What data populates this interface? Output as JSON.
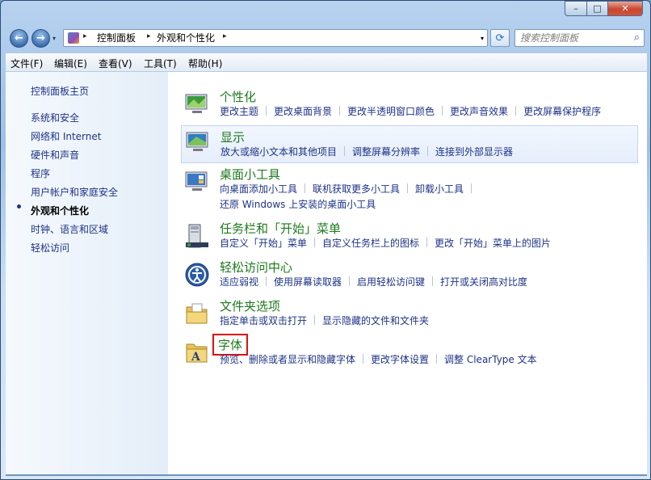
{
  "window": {
    "minimize": "–",
    "maximize": "□",
    "close": "✕"
  },
  "nav": {
    "back_glyph": "←",
    "forward_glyph": "→",
    "dropdown_glyph": "▾",
    "breadcrumb": [
      "控制面板",
      "外观和个性化"
    ],
    "crumb_sep": "▸",
    "address_dropdown": "▾",
    "refresh_glyph": "⟳",
    "search_placeholder": "搜索控制面板",
    "search_icon": "⌕"
  },
  "menu": [
    "文件(F)",
    "编辑(E)",
    "查看(V)",
    "工具(T)",
    "帮助(H)"
  ],
  "sidebar": {
    "home": "控制面板主页",
    "items": [
      "系统和安全",
      "网络和 Internet",
      "硬件和声音",
      "程序",
      "用户帐户和家庭安全",
      "外观和个性化",
      "时钟、语言和区域",
      "轻松访问"
    ],
    "current_index": 5
  },
  "categories": [
    {
      "title": "个性化",
      "icon": "personalization-icon",
      "link_lines": [
        [
          "更改主题",
          "更改桌面背景",
          "更改半透明窗口颜色",
          "更改声音效果",
          "更改屏幕保护程序"
        ]
      ]
    },
    {
      "title": "显示",
      "icon": "display-icon",
      "link_lines": [
        [
          "放大或缩小文本和其他项目",
          "调整屏幕分辨率",
          "连接到外部显示器"
        ]
      ]
    },
    {
      "title": "桌面小工具",
      "icon": "gadgets-icon",
      "link_lines": [
        [
          "向桌面添加小工具",
          "联机获取更多小工具",
          "卸载小工具"
        ],
        [
          "还原 Windows 上安装的桌面小工具"
        ]
      ]
    },
    {
      "title": "任务栏和「开始」菜单",
      "icon": "taskbar-icon",
      "link_lines": [
        [
          "自定义「开始」菜单",
          "自定义任务栏上的图标",
          "更改「开始」菜单上的图片"
        ]
      ]
    },
    {
      "title": "轻松访问中心",
      "icon": "ease-of-access-icon",
      "link_lines": [
        [
          "适应弱视",
          "使用屏幕读取器",
          "启用轻松访问键",
          "打开或关闭高对比度"
        ]
      ]
    },
    {
      "title": "文件夹选项",
      "icon": "folder-options-icon",
      "link_lines": [
        [
          "指定单击或双击打开",
          "显示隐藏的文件和文件夹"
        ]
      ]
    },
    {
      "title": "字体",
      "icon": "fonts-icon",
      "link_lines": [
        [
          "预览、删除或者显示和隐藏字体",
          "更改字体设置",
          "调整 ClearType 文本"
        ]
      ]
    }
  ],
  "colors": {
    "category_title": "#1e7a1e",
    "link": "#1e3287",
    "highlight_box": "#e01010"
  }
}
